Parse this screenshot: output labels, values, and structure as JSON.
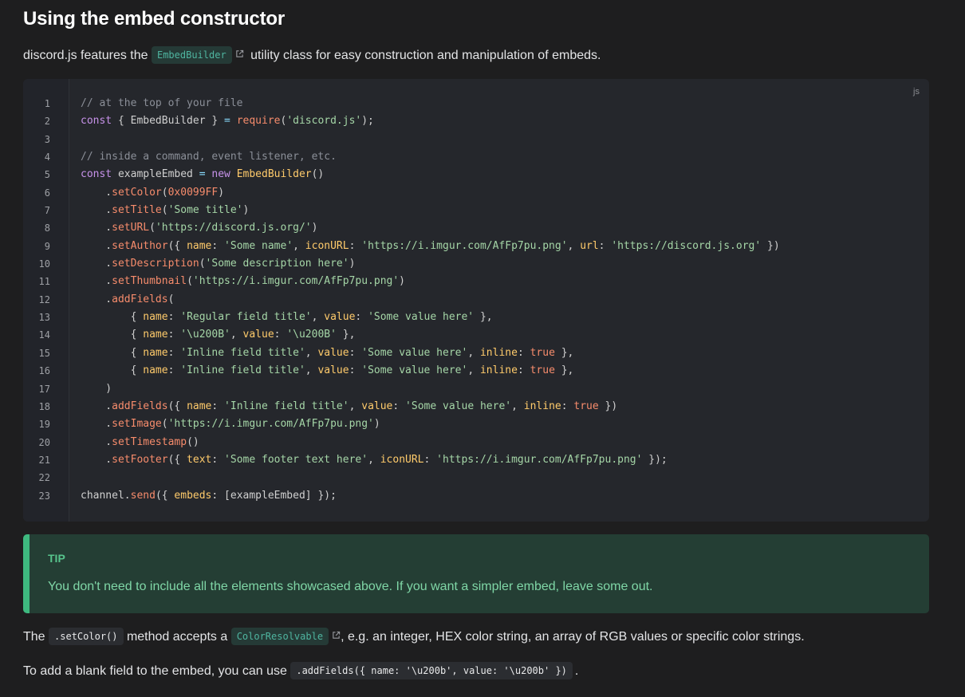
{
  "heading": "Using the embed constructor",
  "intro": {
    "before": "discord.js features the ",
    "code": "EmbedBuilder",
    "after": " utility class for easy construction and manipulation of embeds."
  },
  "code_block": {
    "language": "js",
    "lines": [
      [
        {
          "t": "comment",
          "v": "// at the top of your file"
        }
      ],
      [
        {
          "t": "keyword",
          "v": "const"
        },
        {
          "t": "punc",
          "v": " { EmbedBuilder } "
        },
        {
          "t": "op",
          "v": "="
        },
        {
          "t": "punc",
          "v": " "
        },
        {
          "t": "fn",
          "v": "require"
        },
        {
          "t": "punc",
          "v": "("
        },
        {
          "t": "string",
          "v": "'discord.js'"
        },
        {
          "t": "punc",
          "v": ");"
        }
      ],
      [],
      [
        {
          "t": "comment",
          "v": "// inside a command, event listener, etc."
        }
      ],
      [
        {
          "t": "keyword",
          "v": "const"
        },
        {
          "t": "punc",
          "v": " exampleEmbed "
        },
        {
          "t": "op",
          "v": "="
        },
        {
          "t": "punc",
          "v": " "
        },
        {
          "t": "keyword",
          "v": "new"
        },
        {
          "t": "punc",
          "v": " "
        },
        {
          "t": "class",
          "v": "EmbedBuilder"
        },
        {
          "t": "punc",
          "v": "()"
        }
      ],
      [
        {
          "t": "punc",
          "v": "    ."
        },
        {
          "t": "fn",
          "v": "setColor"
        },
        {
          "t": "punc",
          "v": "("
        },
        {
          "t": "number",
          "v": "0x0099FF"
        },
        {
          "t": "punc",
          "v": ")"
        }
      ],
      [
        {
          "t": "punc",
          "v": "    ."
        },
        {
          "t": "fn",
          "v": "setTitle"
        },
        {
          "t": "punc",
          "v": "("
        },
        {
          "t": "string",
          "v": "'Some title'"
        },
        {
          "t": "punc",
          "v": ")"
        }
      ],
      [
        {
          "t": "punc",
          "v": "    ."
        },
        {
          "t": "fn",
          "v": "setURL"
        },
        {
          "t": "punc",
          "v": "("
        },
        {
          "t": "string",
          "v": "'https://discord.js.org/'"
        },
        {
          "t": "punc",
          "v": ")"
        }
      ],
      [
        {
          "t": "punc",
          "v": "    ."
        },
        {
          "t": "fn",
          "v": "setAuthor"
        },
        {
          "t": "punc",
          "v": "({ "
        },
        {
          "t": "prop",
          "v": "name"
        },
        {
          "t": "punc",
          "v": ": "
        },
        {
          "t": "string",
          "v": "'Some name'"
        },
        {
          "t": "punc",
          "v": ", "
        },
        {
          "t": "prop",
          "v": "iconURL"
        },
        {
          "t": "punc",
          "v": ": "
        },
        {
          "t": "string",
          "v": "'https://i.imgur.com/AfFp7pu.png'"
        },
        {
          "t": "punc",
          "v": ", "
        },
        {
          "t": "prop",
          "v": "url"
        },
        {
          "t": "punc",
          "v": ": "
        },
        {
          "t": "string",
          "v": "'https://discord.js.org'"
        },
        {
          "t": "punc",
          "v": " })"
        }
      ],
      [
        {
          "t": "punc",
          "v": "    ."
        },
        {
          "t": "fn",
          "v": "setDescription"
        },
        {
          "t": "punc",
          "v": "("
        },
        {
          "t": "string",
          "v": "'Some description here'"
        },
        {
          "t": "punc",
          "v": ")"
        }
      ],
      [
        {
          "t": "punc",
          "v": "    ."
        },
        {
          "t": "fn",
          "v": "setThumbnail"
        },
        {
          "t": "punc",
          "v": "("
        },
        {
          "t": "string",
          "v": "'https://i.imgur.com/AfFp7pu.png'"
        },
        {
          "t": "punc",
          "v": ")"
        }
      ],
      [
        {
          "t": "punc",
          "v": "    ."
        },
        {
          "t": "fn",
          "v": "addFields"
        },
        {
          "t": "punc",
          "v": "("
        }
      ],
      [
        {
          "t": "punc",
          "v": "        { "
        },
        {
          "t": "prop",
          "v": "name"
        },
        {
          "t": "punc",
          "v": ": "
        },
        {
          "t": "string",
          "v": "'Regular field title'"
        },
        {
          "t": "punc",
          "v": ", "
        },
        {
          "t": "prop",
          "v": "value"
        },
        {
          "t": "punc",
          "v": ": "
        },
        {
          "t": "string",
          "v": "'Some value here'"
        },
        {
          "t": "punc",
          "v": " },"
        }
      ],
      [
        {
          "t": "punc",
          "v": "        { "
        },
        {
          "t": "prop",
          "v": "name"
        },
        {
          "t": "punc",
          "v": ": "
        },
        {
          "t": "string",
          "v": "'\\u200B'"
        },
        {
          "t": "punc",
          "v": ", "
        },
        {
          "t": "prop",
          "v": "value"
        },
        {
          "t": "punc",
          "v": ": "
        },
        {
          "t": "string",
          "v": "'\\u200B'"
        },
        {
          "t": "punc",
          "v": " },"
        }
      ],
      [
        {
          "t": "punc",
          "v": "        { "
        },
        {
          "t": "prop",
          "v": "name"
        },
        {
          "t": "punc",
          "v": ": "
        },
        {
          "t": "string",
          "v": "'Inline field title'"
        },
        {
          "t": "punc",
          "v": ", "
        },
        {
          "t": "prop",
          "v": "value"
        },
        {
          "t": "punc",
          "v": ": "
        },
        {
          "t": "string",
          "v": "'Some value here'"
        },
        {
          "t": "punc",
          "v": ", "
        },
        {
          "t": "prop",
          "v": "inline"
        },
        {
          "t": "punc",
          "v": ": "
        },
        {
          "t": "bool",
          "v": "true"
        },
        {
          "t": "punc",
          "v": " },"
        }
      ],
      [
        {
          "t": "punc",
          "v": "        { "
        },
        {
          "t": "prop",
          "v": "name"
        },
        {
          "t": "punc",
          "v": ": "
        },
        {
          "t": "string",
          "v": "'Inline field title'"
        },
        {
          "t": "punc",
          "v": ", "
        },
        {
          "t": "prop",
          "v": "value"
        },
        {
          "t": "punc",
          "v": ": "
        },
        {
          "t": "string",
          "v": "'Some value here'"
        },
        {
          "t": "punc",
          "v": ", "
        },
        {
          "t": "prop",
          "v": "inline"
        },
        {
          "t": "punc",
          "v": ": "
        },
        {
          "t": "bool",
          "v": "true"
        },
        {
          "t": "punc",
          "v": " },"
        }
      ],
      [
        {
          "t": "punc",
          "v": "    )"
        }
      ],
      [
        {
          "t": "punc",
          "v": "    ."
        },
        {
          "t": "fn",
          "v": "addFields"
        },
        {
          "t": "punc",
          "v": "({ "
        },
        {
          "t": "prop",
          "v": "name"
        },
        {
          "t": "punc",
          "v": ": "
        },
        {
          "t": "string",
          "v": "'Inline field title'"
        },
        {
          "t": "punc",
          "v": ", "
        },
        {
          "t": "prop",
          "v": "value"
        },
        {
          "t": "punc",
          "v": ": "
        },
        {
          "t": "string",
          "v": "'Some value here'"
        },
        {
          "t": "punc",
          "v": ", "
        },
        {
          "t": "prop",
          "v": "inline"
        },
        {
          "t": "punc",
          "v": ": "
        },
        {
          "t": "bool",
          "v": "true"
        },
        {
          "t": "punc",
          "v": " })"
        }
      ],
      [
        {
          "t": "punc",
          "v": "    ."
        },
        {
          "t": "fn",
          "v": "setImage"
        },
        {
          "t": "punc",
          "v": "("
        },
        {
          "t": "string",
          "v": "'https://i.imgur.com/AfFp7pu.png'"
        },
        {
          "t": "punc",
          "v": ")"
        }
      ],
      [
        {
          "t": "punc",
          "v": "    ."
        },
        {
          "t": "fn",
          "v": "setTimestamp"
        },
        {
          "t": "punc",
          "v": "()"
        }
      ],
      [
        {
          "t": "punc",
          "v": "    ."
        },
        {
          "t": "fn",
          "v": "setFooter"
        },
        {
          "t": "punc",
          "v": "({ "
        },
        {
          "t": "prop",
          "v": "text"
        },
        {
          "t": "punc",
          "v": ": "
        },
        {
          "t": "string",
          "v": "'Some footer text here'"
        },
        {
          "t": "punc",
          "v": ", "
        },
        {
          "t": "prop",
          "v": "iconURL"
        },
        {
          "t": "punc",
          "v": ": "
        },
        {
          "t": "string",
          "v": "'https://i.imgur.com/AfFp7pu.png'"
        },
        {
          "t": "punc",
          "v": " });"
        }
      ],
      [],
      [
        {
          "t": "punc",
          "v": "channel."
        },
        {
          "t": "fn",
          "v": "send"
        },
        {
          "t": "punc",
          "v": "({ "
        },
        {
          "t": "prop",
          "v": "embeds"
        },
        {
          "t": "punc",
          "v": ": [exampleEmbed] });"
        }
      ]
    ]
  },
  "tip": {
    "title": "TIP",
    "text": "You don't need to include all the elements showcased above. If you want a simpler embed, leave some out."
  },
  "setcolor_para": {
    "before": "The ",
    "code": ".setColor()",
    "middle": " method accepts a ",
    "link_code": "ColorResolvable",
    "after": ", e.g. an integer, HEX color string, an array of RGB values or specific color strings."
  },
  "blank_field_para": {
    "before": "To add a blank field to the embed, you can use ",
    "code": ".addFields({ name: '\\u200b', value: '\\u200b' })",
    "after": "."
  }
}
